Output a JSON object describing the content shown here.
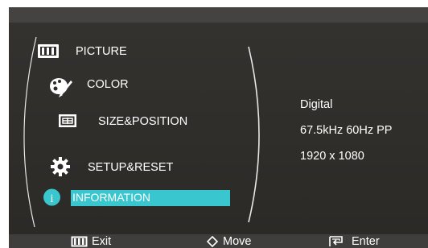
{
  "menu": {
    "items": [
      {
        "label": "PICTURE",
        "icon": "picture-icon",
        "selected": false
      },
      {
        "label": "COLOR",
        "icon": "color-palette-icon",
        "selected": false
      },
      {
        "label": "SIZE&POSITION",
        "icon": "size-position-icon",
        "selected": false
      },
      {
        "label": "SETUP&RESET",
        "icon": "gear-icon",
        "selected": false
      },
      {
        "label": "INFORMATION",
        "icon": "info-icon",
        "selected": true
      }
    ]
  },
  "info": {
    "lines": [
      "Digital",
      "67.5kHz 60Hz PP",
      "1920 x 1080"
    ]
  },
  "footer": {
    "exit_label": "Exit",
    "move_label": "Move",
    "enter_label": "Enter"
  },
  "colors": {
    "highlight": "#3ac6cf",
    "background": "#2f2d2b",
    "info_icon": "#3ac6cf"
  }
}
